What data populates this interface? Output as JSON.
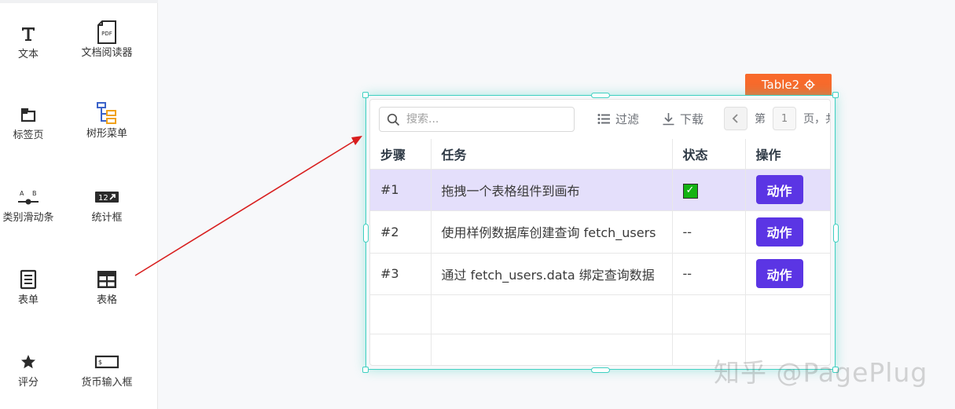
{
  "palette": {
    "items": [
      {
        "label": "文本",
        "icon": "text-icon"
      },
      {
        "label": "文档阅读器",
        "icon": "pdf-icon",
        "icon_text": "PDF"
      },
      {
        "label": "标签页",
        "icon": "tabs-icon"
      },
      {
        "label": "树形菜单",
        "icon": "tree-icon"
      },
      {
        "label": "类别滑动条",
        "icon": "category-slider-icon",
        "icon_text_a": "A",
        "icon_text_b": "B"
      },
      {
        "label": "统计框",
        "icon": "stat-box-icon",
        "icon_text": "12"
      },
      {
        "label": "表单",
        "icon": "form-icon"
      },
      {
        "label": "表格",
        "icon": "table-icon"
      },
      {
        "label": "评分",
        "icon": "star-icon"
      },
      {
        "label": "货币输入框",
        "icon": "currency-input-icon",
        "icon_text": "$"
      }
    ]
  },
  "widget": {
    "name": "Table2",
    "search_placeholder": "搜索...",
    "filter_label": "过滤",
    "download_label": "下载",
    "page_prefix": "第",
    "page_number": "1",
    "page_suffix": "页，共"
  },
  "table": {
    "columns": [
      "步骤",
      "任务",
      "状态",
      "操作"
    ],
    "rows": [
      {
        "step": "#1",
        "task": "拖拽一个表格组件到画布",
        "status": "checked",
        "action": "动作"
      },
      {
        "step": "#2",
        "task": "使用样例数据库创建查询 fetch_users",
        "status": "--",
        "action": "动作"
      },
      {
        "step": "#3",
        "task": "通过 fetch_users.data 绑定查询数据",
        "status": "--",
        "action": "动作"
      }
    ]
  },
  "watermark": "知乎 @PagePlug",
  "colors": {
    "accent": "#5b35e4",
    "selection": "#3fd0c1",
    "tag": "#f86a2b",
    "selected_row": "#e4dffb",
    "arrow": "#d81e1e"
  }
}
